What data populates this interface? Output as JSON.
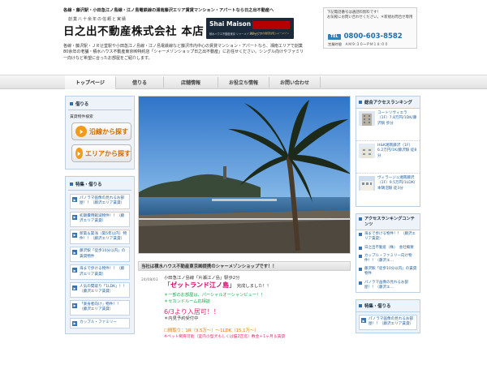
{
  "header": {
    "top_line": "各線・藤沢駅・小田急江ノ島線・江ノ島電鉄線の湘南藤沢エリア賃貸マンション・アパートなら日之出不動産へ",
    "logo_tagline": "創業八十余年の信頼と実績",
    "logo_name": "日之出不動産株式会社 本店",
    "brand_title": "Shai Maison",
    "brand_sub": "積水ハウス不動産東京 シャーメゾンショップ",
    "brand_note": "積水ハウスの賃貸住宅シャーメゾン",
    "intro": "各線・藤沢駅・ＪＲ辻堂駅や小田急江ノ島線・江ノ島電鉄線など藤沢市内中心の賃貸マンション・アパートなら、湘南エリアで創業80余年の老舗・積水ハウス不動産東京㈱特約店「シャーメゾンショップ日之出不動産」にお任せください。シングル向けやファミリー向けなど希望に合ったお部屋をご紹介します。",
    "contact_line1": "下記電話番号は通話料無料です！",
    "contact_line2": "お気軽にお問い合わせください。＊新規お問合せ専用",
    "tel_label": "TEL",
    "tel_number": "0800-603-8582",
    "hours": "営業時間　ＡＭ９:３０～ＰＭ１８:００"
  },
  "nav": {
    "items": [
      {
        "label": "トップページ"
      },
      {
        "label": "借りる"
      },
      {
        "label": "店舗情報"
      },
      {
        "label": "お役立ち情報"
      },
      {
        "label": "お問い合わせ"
      }
    ]
  },
  "left": {
    "rent_head": "借りる",
    "rent_caption": "賃貸物件検索",
    "search_line": "沿線から探す",
    "search_area": "エリアから探す",
    "features_head": "特集・借りる",
    "features": [
      "パノラマ画像の見れるお部屋！！（藤沢エリア賃貸）",
      "初期費用軽減物件！！（藤沢エリア賃貸）",
      "新築＆築浅（築5年以内）物件！！（藤沢エリア賃貸）",
      "藤沢駅「徒歩10分以内」の賃貸物件",
      "海まで歩ける物件！！（藤沢エリア賃貸）",
      "人気の間取り「1LDK」！！（藤沢エリア賃貸）",
      "「楽身者向け」物件！！（藤沢エリア賃貸）",
      "カップル・ファミリー"
    ]
  },
  "main": {
    "caption_bar": "当社は積水ハウス不動産東京㈱提携のシャーメゾンショップです！！",
    "post_date": "24/08/03",
    "post_line1": "小田急江ノ島線「片瀬江ノ島」駅歩2分",
    "post_title_quote_open": "「",
    "post_title": "ゼットランド江ノ島",
    "post_title_quote_close": "」",
    "post_title_suffix": "完成しました！！",
    "green_lines": [
      "＊一部のお部屋は、パーシャルオーシャンビュー！！",
      "＊セカンドルーム応相談"
    ],
    "big_pink": "6/3より入居可！！",
    "preview_note": "＊内見予約受付中",
    "orange_line": "☐間取り：1R（9.5万～）～1LDK（15.1万～）",
    "pink_line": "※ペット飼育可能（室内小型犬もしくは猫2匹迄）敷金＋1ヶ月＆賃貸"
  },
  "right": {
    "rank_head": "総合アクセスランキング",
    "rank_items": [
      "コートリヴィエラ（1F）7.8万円/1DK/藤沢駅 歩分",
      "H&K湘南藤沢（1F）6.2万円/1K/藤沢駅 徒8分",
      "ヴィラージュ湘南藤沢（1F）9.5万円/1LDK/本鵠沼駅 徒3分"
    ],
    "rank2_head": "アクセスランキングコンテンツ",
    "rank2_items": [
      "海まで歩ける物件！！（藤沢エリア賃貸）",
      "日之出不動産（株）　会社概要",
      "カップル・ファミリー向け物件！！（藤沢エ…",
      "藤沢駅「徒歩10分以内」の賃貸物件",
      "パノラマ画像の見れるお部屋！！（藤沢エ…"
    ],
    "feat2_head": "特集・借りる",
    "feat2_item": "パノラマ画像の見れるお部屋！！（藤沢エリア賃貸）"
  },
  "colors": {
    "accent_blue": "#2f80c0",
    "orange": "#f29a1a",
    "pink": "#e8286f",
    "green": "#1aa84f"
  }
}
